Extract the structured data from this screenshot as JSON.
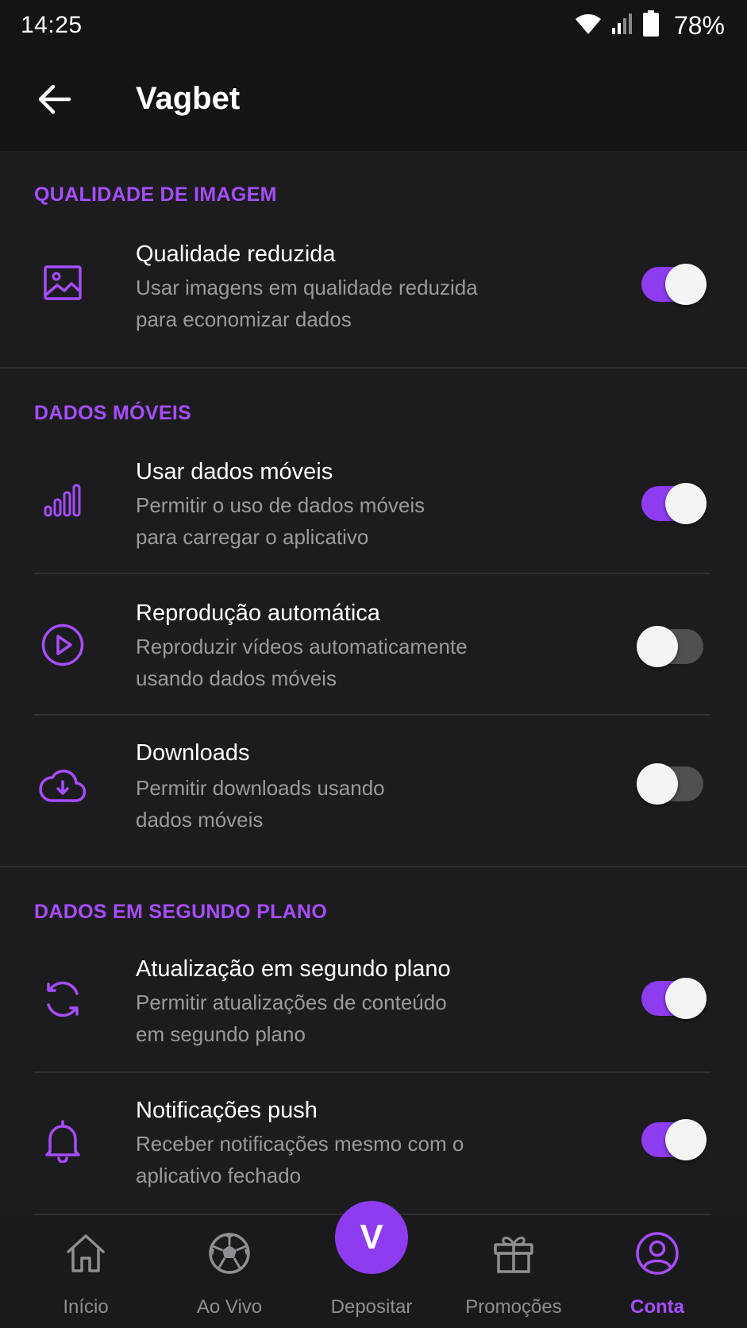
{
  "status_bar": {
    "time": "14:25",
    "battery": "78%",
    "icons": [
      "wifi-icon",
      "cell-signal-icon",
      "battery-icon"
    ]
  },
  "app_bar": {
    "title": "Vagbet",
    "back_icon": "arrow-left-icon"
  },
  "colors": {
    "accent": "#8e3cf0",
    "section_header": "#a64dff",
    "background": "#1c1c1e",
    "toggle_off_track": "#505052"
  },
  "sections": [
    {
      "header": "QUALIDADE DE IMAGEM",
      "items": [
        {
          "icon": "image-icon",
          "title": "Qualidade reduzida",
          "desc_line1": "Usar imagens em qualidade reduzida",
          "desc_line2": "para economizar dados",
          "enabled": true
        }
      ]
    },
    {
      "header": "DADOS MÓVEIS",
      "items": [
        {
          "icon": "signal-bars-icon",
          "title": "Usar dados móveis",
          "desc_line1": "Permitir o uso de dados móveis",
          "desc_line2": "para carregar o aplicativo",
          "enabled": true
        },
        {
          "icon": "play-circle-icon",
          "title": "Reprodução automática",
          "desc_line1": "Reproduzir vídeos automaticamente",
          "desc_line2": "usando dados móveis",
          "enabled": false
        },
        {
          "icon": "cloud-download-icon",
          "title": "Downloads",
          "desc_line1": "Permitir downloads usando",
          "desc_line2": "dados móveis",
          "enabled": false
        }
      ]
    },
    {
      "header": "DADOS EM SEGUNDO PLANO",
      "items": [
        {
          "icon": "sync-icon",
          "title": "Atualização em segundo plano",
          "desc_line1": "Permitir atualizações de conteúdo",
          "desc_line2": "em segundo plano",
          "enabled": true
        },
        {
          "icon": "bell-icon",
          "title": "Notificações push",
          "desc_line1": "Receber notificações mesmo com o",
          "desc_line2": "aplicativo fechado",
          "enabled": true
        }
      ]
    }
  ],
  "bottom_nav": {
    "items": [
      {
        "label": "Início",
        "icon": "home-icon",
        "active": false
      },
      {
        "label": "Ao Vivo",
        "icon": "soccer-ball-icon",
        "active": false
      },
      {
        "label": "Depositar",
        "icon": "vagbet-logo-icon",
        "active": false,
        "fab_letter": "V"
      },
      {
        "label": "Promoções",
        "icon": "gift-icon",
        "active": false
      },
      {
        "label": "Conta",
        "icon": "account-circle-icon",
        "active": true
      }
    ]
  }
}
